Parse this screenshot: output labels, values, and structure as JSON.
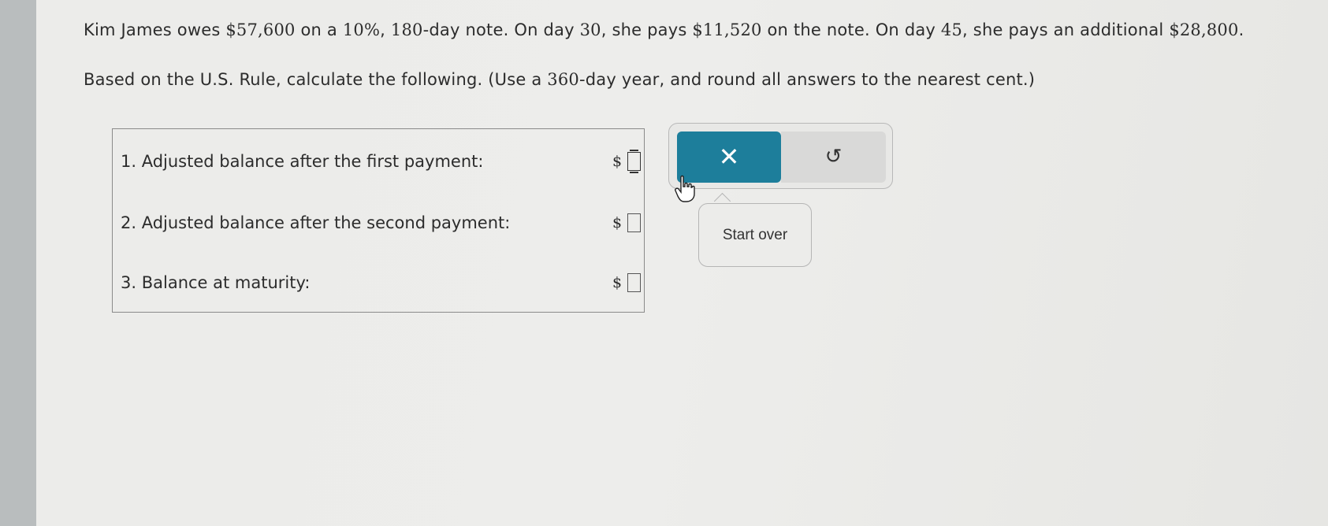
{
  "problem": {
    "text_prefix": "Kim James owes ",
    "principal": "$57,600",
    "text_a": " on a ",
    "rate": "10%",
    "text_b": ", ",
    "term": "180",
    "text_c": "-day note. On day ",
    "day1": "30",
    "text_d": ", she pays ",
    "payment1": "$11,520",
    "text_e": " on the note. On day ",
    "day2": "45",
    "text_f": ", she pays an additional ",
    "payment2": "$28,800",
    "text_g": "."
  },
  "instructions": {
    "prefix": "Based on the U.S. Rule, calculate the following. (Use a ",
    "days": "360",
    "suffix": "-day year, and round all answers to the nearest cent.)"
  },
  "answers": [
    {
      "label": "1. Adjusted balance after the first payment:",
      "currency": "$",
      "value": ""
    },
    {
      "label": "2. Adjusted balance after the second payment:",
      "currency": "$",
      "value": ""
    },
    {
      "label": "3. Balance at maturity:",
      "currency": "$",
      "value": ""
    }
  ],
  "actions": {
    "clear_glyph": "✕",
    "reset_glyph": "↺",
    "tooltip": "Start over"
  },
  "icons": {
    "clear": "close-icon",
    "reset": "undo-icon",
    "cursor": "hand-pointer-icon"
  },
  "colors": {
    "accent": "#1d7e9b"
  }
}
